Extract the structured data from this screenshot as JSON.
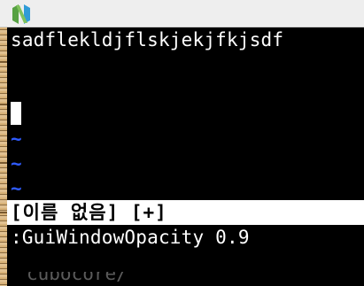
{
  "window": {
    "app_icon": "neovim-logo-icon",
    "accent_colors": {
      "logo_green": "#57a143",
      "logo_blue": "#2f9bd7",
      "tilde_blue": "#2f5bff"
    }
  },
  "editor": {
    "buffer_lines": [
      "sadflekldjflskjekjfkjsdf",
      ""
    ],
    "empty_line_marker": "~",
    "statusline": "[이름 없음] [+]",
    "command_line": ":GuiWindowOpacity 0.9",
    "behind_window_text": "cubocore/"
  }
}
